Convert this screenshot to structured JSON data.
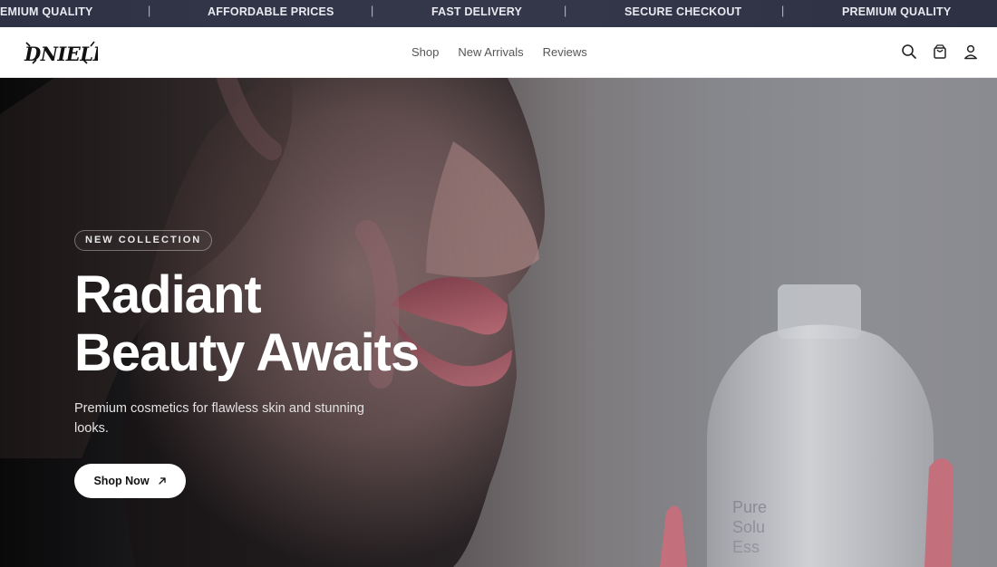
{
  "marquee": {
    "items": [
      "EMIUM QUALITY",
      "AFFORDABLE PRICES",
      "FAST DELIVERY",
      "SECURE CHECKOUT",
      "PREMIUM QUALITY"
    ],
    "separator": "|"
  },
  "header": {
    "brand": "DNIELLE",
    "nav": [
      "Shop",
      "New Arrivals",
      "Reviews"
    ],
    "icons": [
      "search-icon",
      "cart-icon",
      "user-icon"
    ]
  },
  "hero": {
    "badge": "NEW COLLECTION",
    "title_line1": "Radiant",
    "title_line2": "Beauty Awaits",
    "subtitle": "Premium cosmetics for flawless skin and stunning looks.",
    "cta_label": "Shop Now",
    "cta_icon": "arrow-up-right-icon",
    "bottle_label": "Pure Solu Ess"
  },
  "colors": {
    "marquee_bg": "#2f3245",
    "marquee_text": "#e9e9f0",
    "header_bg": "#ffffff",
    "nav_text": "#555555",
    "cta_bg": "#ffffff",
    "headline": "#ffffff"
  }
}
